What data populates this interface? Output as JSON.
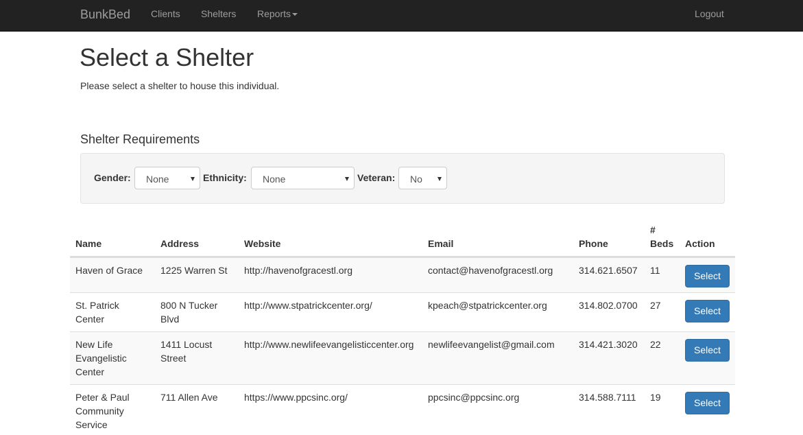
{
  "navbar": {
    "brand": "BunkBed",
    "links": [
      "Clients",
      "Shelters",
      "Reports"
    ],
    "logout": "Logout"
  },
  "header": {
    "title": "Select a Shelter",
    "subtitle": "Please select a shelter to house this individual."
  },
  "requirements": {
    "title": "Shelter Requirements",
    "gender_label": "Gender:",
    "gender_value": "None",
    "ethnicity_label": "Ethnicity:",
    "ethnicity_value": "None",
    "veteran_label": "Veteran:",
    "veteran_value": "No"
  },
  "table": {
    "headers": {
      "name": "Name",
      "address": "Address",
      "website": "Website",
      "email": "Email",
      "phone": "Phone",
      "beds_line1": "#",
      "beds_line2": "Beds",
      "action": "Action"
    },
    "rows": [
      {
        "name": [
          "Haven of Grace"
        ],
        "address": [
          "1225 Warren St"
        ],
        "website": "http://havenofgracestl.org",
        "email": "contact@havenofgracestl.org",
        "phone": "314.621.6507",
        "beds": "11",
        "action": "Select"
      },
      {
        "name": [
          "St. Patrick",
          "Center"
        ],
        "address": [
          "800 N Tucker",
          "Blvd"
        ],
        "website": "http://www.stpatrickcenter.org/",
        "email": "kpeach@stpatrickcenter.org",
        "phone": "314.802.0700",
        "beds": "27",
        "action": "Select"
      },
      {
        "name": [
          "New Life",
          "Evangelistic",
          "Center"
        ],
        "address": [
          "1411 Locust",
          "Street"
        ],
        "website": "http://www.newlifeevangelisticcenter.org",
        "email": "newlifeevangelist@gmail.com",
        "phone": "314.421.3020",
        "beds": "22",
        "action": "Select"
      },
      {
        "name": [
          "Peter & Paul",
          "Community",
          "Service"
        ],
        "address": [
          "711 Allen Ave"
        ],
        "website": "https://www.ppcsinc.org/",
        "email": "ppcsinc@ppcsinc.org",
        "phone": "314.588.7111",
        "beds": "19",
        "action": "Select"
      }
    ]
  }
}
